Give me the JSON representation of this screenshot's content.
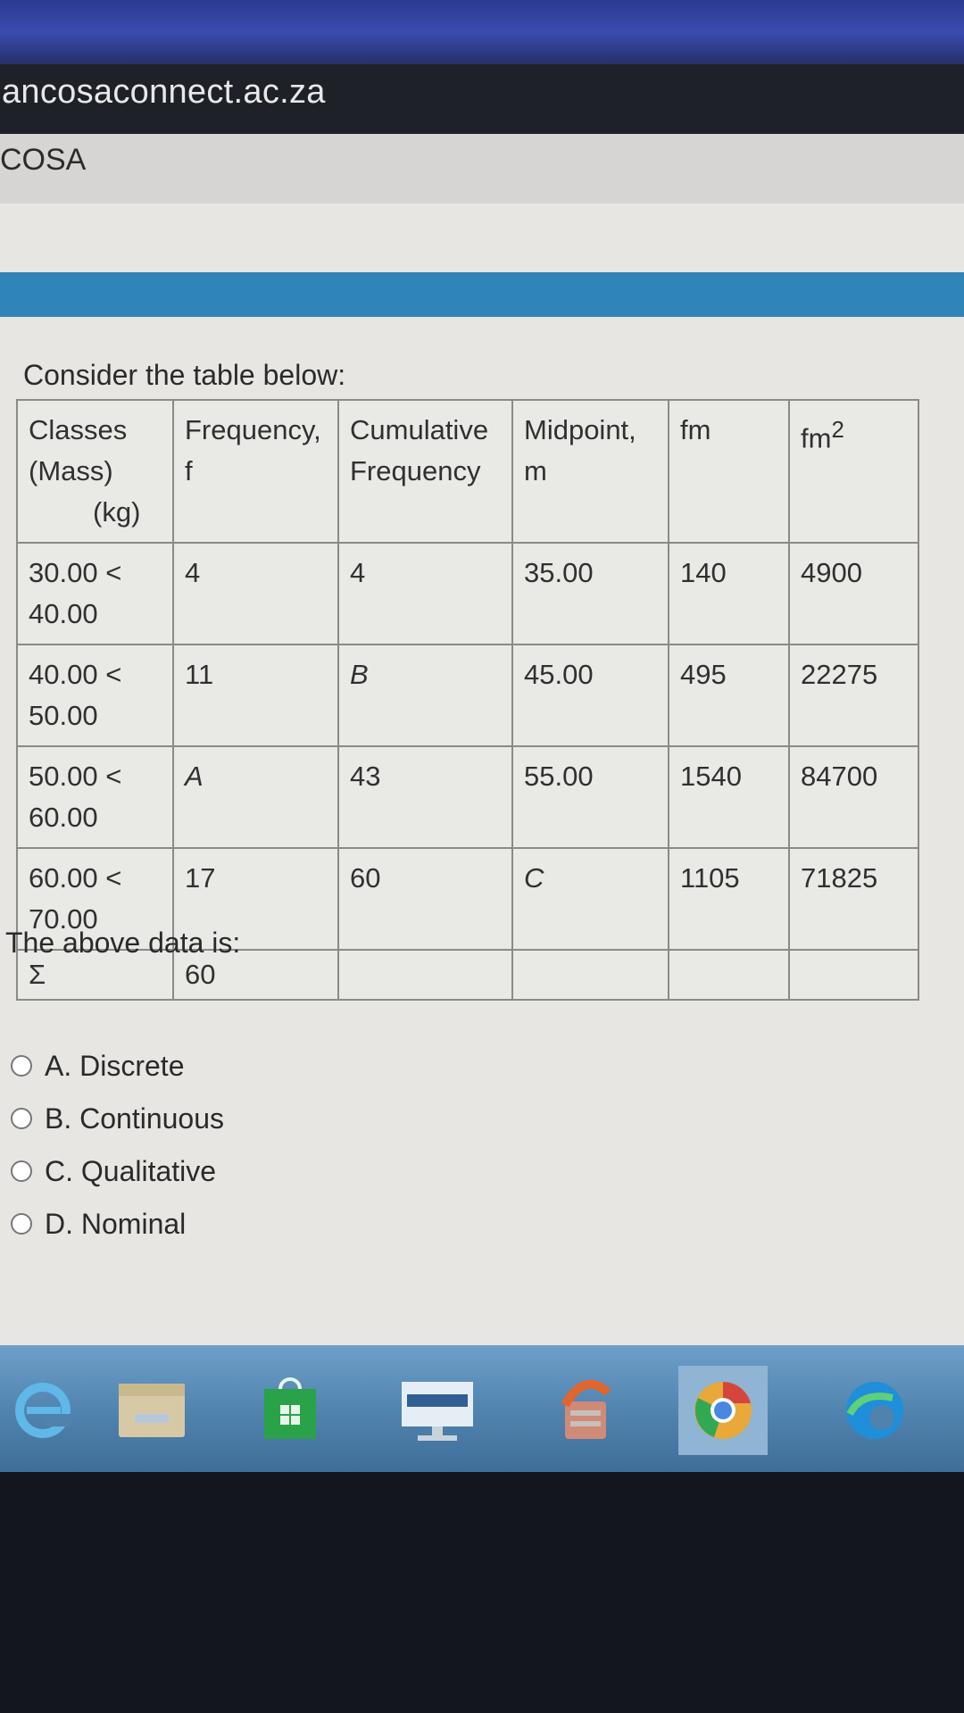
{
  "browser": {
    "url": "ancosaconnect.ac.za"
  },
  "site": {
    "name": "COSA"
  },
  "question": {
    "intro": "Consider the table below:",
    "table": {
      "headers": {
        "classes_line1": "Classes",
        "classes_line2": "(Mass)",
        "classes_line3": "(kg)",
        "frequency_line1": "Frequency,",
        "frequency_line2": "f",
        "cumulative_line1": "Cumulative",
        "cumulative_line2": "Frequency",
        "midpoint_line1": "Midpoint,",
        "midpoint_line2": "m",
        "fm": "fm",
        "fm2_base": "fm",
        "fm2_exp": "2"
      },
      "rows": [
        {
          "class_from": "30.00 <",
          "class_to": "40.00",
          "f": "4",
          "cf": "4",
          "m": "35.00",
          "fm": "140",
          "fm2": "4900"
        },
        {
          "class_from": "40.00 <",
          "class_to": "50.00",
          "f": "11",
          "cf": "B",
          "m": "45.00",
          "fm": "495",
          "fm2": "22275"
        },
        {
          "class_from": "50.00 <",
          "class_to": "60.00",
          "f": "A",
          "cf": "43",
          "m": "55.00",
          "fm": "1540",
          "fm2": "84700"
        },
        {
          "class_from": "60.00 <",
          "class_to": "70.00",
          "f": "17",
          "cf": "60",
          "m": "C",
          "fm": "1105",
          "fm2": "71825"
        }
      ],
      "total": {
        "symbol": "Σ",
        "f": "60"
      }
    },
    "prompt": "The above data is:",
    "options": [
      {
        "label": "A. Discrete"
      },
      {
        "label": "B. Continuous"
      },
      {
        "label": "C. Qualitative"
      },
      {
        "label": "D. Nominal"
      }
    ]
  },
  "taskbar": {
    "icons": [
      "internet-explorer-icon",
      "file-explorer-icon",
      "store-icon",
      "monitor-app-icon",
      "security-app-icon",
      "chrome-icon",
      "edge-icon"
    ]
  },
  "colors": {
    "accent_band": "#2f84b8",
    "taskbar": "#4f82ad"
  }
}
